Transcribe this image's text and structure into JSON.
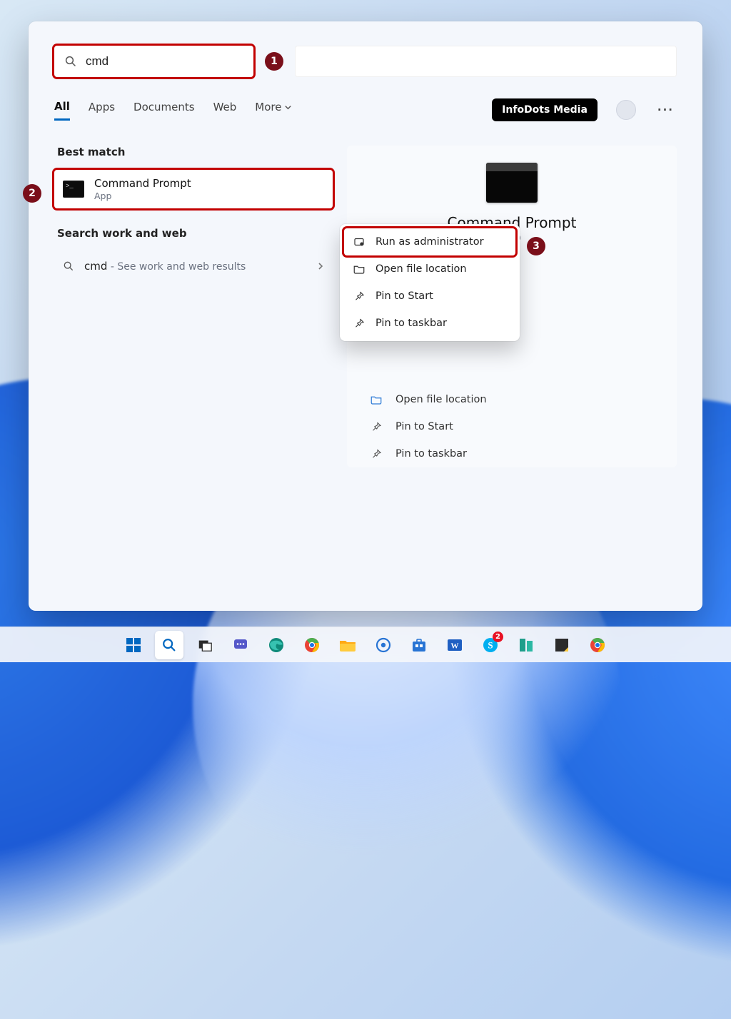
{
  "search": {
    "query": "cmd"
  },
  "filters": {
    "all": "All",
    "apps": "Apps",
    "documents": "Documents",
    "web": "Web",
    "more": "More"
  },
  "user": {
    "label": "InfoDots Media"
  },
  "sections": {
    "best_match": "Best match",
    "work_web": "Search work and web"
  },
  "best_match": {
    "title": "Command Prompt",
    "subtitle": "App"
  },
  "web_result": {
    "term": "cmd",
    "suffix": " - See work and web results"
  },
  "hero": {
    "title": "Command Prompt",
    "subtitle": "App"
  },
  "context_menu": {
    "run_admin": "Run as administrator",
    "open_loc": "Open file location",
    "pin_start": "Pin to Start",
    "pin_taskbar": "Pin to taskbar"
  },
  "panel_actions": {
    "open_loc": "Open file location",
    "pin_start": "Pin to Start",
    "pin_taskbar": "Pin to taskbar"
  },
  "annotations": {
    "one": "1",
    "two": "2",
    "three": "3"
  },
  "taskbar": {
    "skype_badge": "2"
  }
}
